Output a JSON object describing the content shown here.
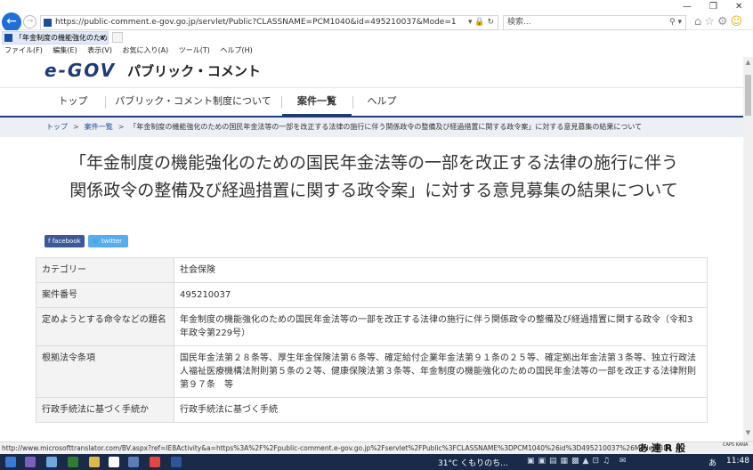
{
  "browser": {
    "url": "https://public-comment.e-gov.go.jp/servlet/Public?CLASSNAME=PCM1040&id=495210037&Mode=1",
    "search_placeholder": "検索...",
    "tab_title": "「年金制度の機能強化のため...",
    "menu": [
      "ファイル(F)",
      "編集(E)",
      "表示(V)",
      "お気に入り(A)",
      "ツール(T)",
      "ヘルプ(H)"
    ],
    "window_controls": [
      "—",
      "❐",
      "✕"
    ]
  },
  "site": {
    "logo": "e-GOV",
    "title": "パブリック・コメント"
  },
  "nav": {
    "items": [
      "トップ",
      "パブリック・コメント制度について",
      "案件一覧",
      "ヘルプ"
    ],
    "active": "案件一覧"
  },
  "breadcrumb": {
    "top": "トップ",
    "list": "案件一覧",
    "current": "「年金制度の機能強化のための国民年金法等の一部を改正する法律の施行に伴う関係政令の整備及び経過措置に関する政令案」に対する意見募集の結果について"
  },
  "page": {
    "title_line1": "「年金制度の機能強化のための国民年金法等の一部を改正する法律の施行に伴う",
    "title_line2": "関係政令の整備及び経過措置に関する政令案」に対する意見募集の結果について"
  },
  "share": {
    "facebook": "facebook",
    "twitter": "twitter"
  },
  "info_table": [
    {
      "label": "カテゴリー",
      "value": "社会保険"
    },
    {
      "label": "案件番号",
      "value": "495210037"
    },
    {
      "label": "定めようとする命令などの題名",
      "value": "年金制度の機能強化のための国民年金法等の一部を改正する法律の施行に伴う関係政令の整備及び経過措置に関する政令（令和3年政令第229号）"
    },
    {
      "label": "根拠法令条項",
      "value": "国民年金法第２８条等、厚生年金保険法第６条等、確定給付企業年金法第９１条の２５等、確定拠出年金法第３条等、独立行政法人福祉医療機構法附則第５条の２等、健康保険法第３条等、年金制度の機能強化のための国民年金法等の一部を改正する法律附則第９７条　等"
    },
    {
      "label": "行政手続法に基づく手続か",
      "value": "行政手続法に基づく手続"
    }
  ],
  "statusbar": {
    "url": "http://www.microsofttranslator.com/BV.aspx?ref=IE8Activity&a=https%3A%2F%2Fpublic-comment.e-gov.go.jp%2Fservlet%2FPublic%3FCLASSNAME%3DPCM1040%26id%3D495210037%26Mode%3D1",
    "ime": "あ 連 R 般",
    "caps": "CAPS KANA"
  },
  "taskbar": {
    "weather": "31°C くもりのち...",
    "ime": "あ",
    "time": "11:48"
  }
}
